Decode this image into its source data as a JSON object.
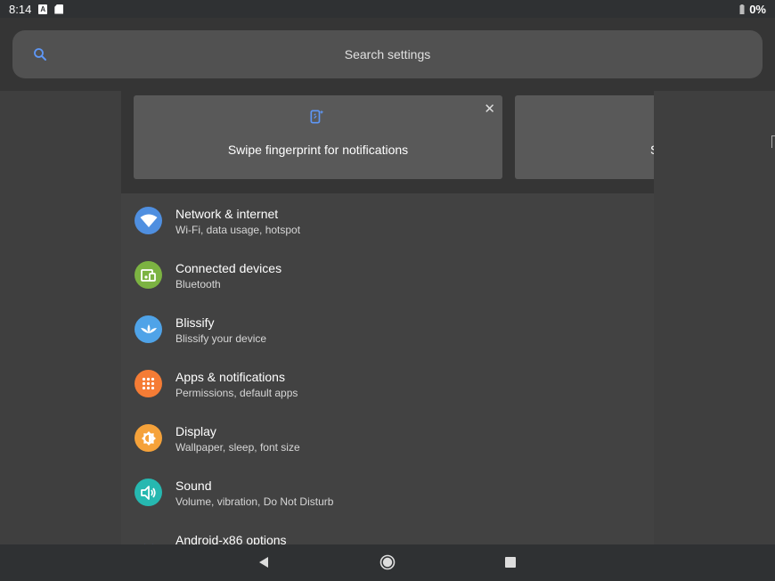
{
  "status_bar": {
    "time": "8:14",
    "battery": "0%",
    "notification_icons": [
      "a-icon",
      "sd-card-icon"
    ],
    "battery_icon": "battery-charging-icon"
  },
  "search": {
    "placeholder": "Search settings",
    "icon": "search-icon",
    "icon_color": "#5e97f6"
  },
  "suggestions": [
    {
      "text": "Swipe fingerprint for notifications",
      "icon": "fingerprint-swipe-icon",
      "dismiss": "close-icon"
    },
    {
      "text": "S"
    }
  ],
  "settings": [
    {
      "title": "Network & internet",
      "subtitle": "Wi-Fi, data usage, hotspot",
      "icon": "wifi-icon",
      "color": "#4f8fe0"
    },
    {
      "title": "Connected devices",
      "subtitle": "Bluetooth",
      "icon": "devices-icon",
      "color": "#7cb342"
    },
    {
      "title": "Blissify",
      "subtitle": "Blissify your device",
      "icon": "lotus-icon",
      "color": "#4fa3e8"
    },
    {
      "title": "Apps & notifications",
      "subtitle": "Permissions, default apps",
      "icon": "apps-grid-icon",
      "color": "#f57c35"
    },
    {
      "title": "Display",
      "subtitle": "Wallpaper, sleep, font size",
      "icon": "brightness-icon",
      "color": "#f5a23a"
    },
    {
      "title": "Sound",
      "subtitle": "Volume, vibration, Do Not Disturb",
      "icon": "volume-icon",
      "color": "#26b8b0"
    },
    {
      "title": "Android-x86 options",
      "subtitle": "",
      "icon": "android-icon",
      "color": "#5c6bc0"
    }
  ],
  "navigation": {
    "back": "back-icon",
    "home": "home-icon",
    "recents": "recents-icon"
  }
}
